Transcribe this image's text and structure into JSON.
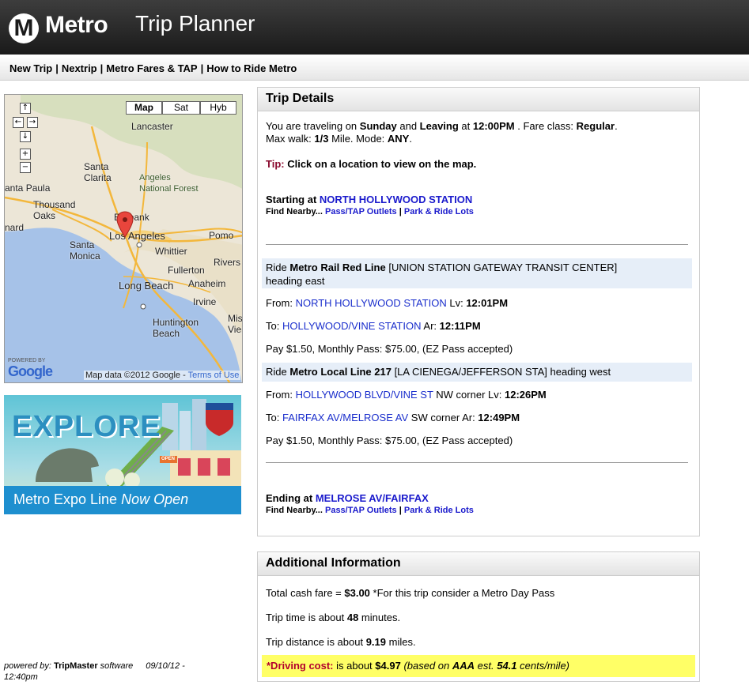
{
  "header": {
    "logo_glyph": "M",
    "logo_text": "Metro",
    "title": "Trip Planner"
  },
  "nav": {
    "items": [
      "New Trip",
      "Nextrip",
      "Metro Fares & TAP",
      "How to Ride Metro"
    ],
    "separator": "|"
  },
  "map": {
    "types": [
      "Map",
      "Sat",
      "Hyb"
    ],
    "active_type": "Map",
    "controls": {
      "up": "↑",
      "left": "←",
      "right": "→",
      "down": "↓",
      "zoom_in": "+",
      "zoom_out": "−"
    },
    "labels": {
      "lancaster": "Lancaster",
      "santa_clarita": "Santa\nClarita",
      "angeles_forest": "Angeles\nNational Forest",
      "santa_paula": "anta Paula",
      "thousand_oaks": "Thousand\nOaks",
      "oxnard": "nard",
      "burbank": "Burbank",
      "los_angeles": "Los Angeles",
      "santa_monica": "Santa\nMonica",
      "whittier": "Whittier",
      "pomona": "Pomo",
      "riverside": "Rivers",
      "fullerton": "Fullerton",
      "long_beach": "Long Beach",
      "anaheim": "Anaheim",
      "irvine": "Irvine",
      "huntington_beach": "Huntington\nBeach",
      "mission_viejo": "Missio\nVieio"
    },
    "shields": [
      "5",
      "210",
      "405",
      "105",
      "5"
    ],
    "powered_by": "POWERED BY",
    "google": "Google",
    "credit": "Map data ©2012 Google - ",
    "terms": "Terms of Use"
  },
  "ad": {
    "headline": "EXPLORE",
    "line_name": "Metro Expo Line",
    "line_status": "Now Open",
    "sign": "OPEN"
  },
  "footer": {
    "prefix": "powered by: ",
    "brand": "TripMaster",
    "suffix": " software",
    "date": "09/10/12 -",
    "time": "12:40pm"
  },
  "trip": {
    "title": "Trip Details",
    "summary": {
      "p1": "You are traveling on ",
      "day": "Sunday",
      "p2": " and ",
      "mode_leave": "Leaving",
      "p3": " at ",
      "time": "12:00PM",
      "p4": " . Fare class: ",
      "fare_class": "Regular",
      "p5": ".",
      "p6": "Max walk: ",
      "max_walk": "1/3",
      "p7": " Mile. Mode: ",
      "mode": "ANY",
      "p8": "."
    },
    "tip_label": "Tip:",
    "tip_text": " Click on a location to view on the map.",
    "start_label": "Starting at ",
    "start_station": "NORTH HOLLYWOOD STATION",
    "find_nearby": "Find Nearby... ",
    "pass_outlets": "Pass/TAP Outlets",
    "park_ride": "Park & Ride Lots",
    "legs": [
      {
        "ride": "Ride ",
        "line": "Metro Rail Red Line",
        "dest": " [UNION STATION GATEWAY TRANSIT CENTER]",
        "heading": "heading east",
        "from_label": "From: ",
        "from_stop": "NORTH HOLLYWOOD STATION",
        "from_extra": "",
        "lv_label": " Lv: ",
        "lv": "12:01PM",
        "to_label": "To: ",
        "to_stop": "HOLLYWOOD/VINE STATION",
        "to_extra": "",
        "ar_label": " Ar: ",
        "ar": "12:11PM",
        "pay": "Pay $1.50, Monthly Pass: $75.00, (EZ Pass accepted)"
      },
      {
        "ride": "Ride ",
        "line": "Metro Local Line 217",
        "dest": " [LA CIENEGA/JEFFERSON STA] heading west",
        "heading": "",
        "from_label": "From: ",
        "from_stop": "HOLLYWOOD BLVD/VINE ST",
        "from_extra": " NW corner",
        "lv_label": " Lv: ",
        "lv": "12:26PM",
        "to_label": "To: ",
        "to_stop": "FAIRFAX AV/MELROSE AV",
        "to_extra": " SW corner",
        "ar_label": " Ar: ",
        "ar": "12:49PM",
        "pay": "Pay $1.50, Monthly Pass: $75.00, (EZ Pass accepted)"
      }
    ],
    "end_label": "Ending at ",
    "end_station": "MELROSE AV/FAIRFAX"
  },
  "info": {
    "title": "Additional Information",
    "fare_label": "Total cash fare = ",
    "fare": "$3.00",
    "fare_note": " *For this trip consider a Metro Day Pass",
    "time_label": "Trip time is about ",
    "time": "48",
    "time_unit": " minutes.",
    "dist_label": "Trip distance is about ",
    "dist": "9.19",
    "dist_unit": " miles.",
    "drive_label": "*Driving cost:",
    "drive_p1": " is about ",
    "drive_cost": "$4.97",
    "drive_p2": " (based on ",
    "aaa": "AAA",
    "drive_p3": " est. ",
    "cents": "54.1",
    "drive_p4": " cents/mile)"
  },
  "colors": {
    "link_blue": "#1a1acc",
    "tip_maroon": "#8a0a2e",
    "highlight": "#ffff66",
    "ride_bg": "#e6eef8",
    "expo_blue": "#1e8fcf"
  }
}
